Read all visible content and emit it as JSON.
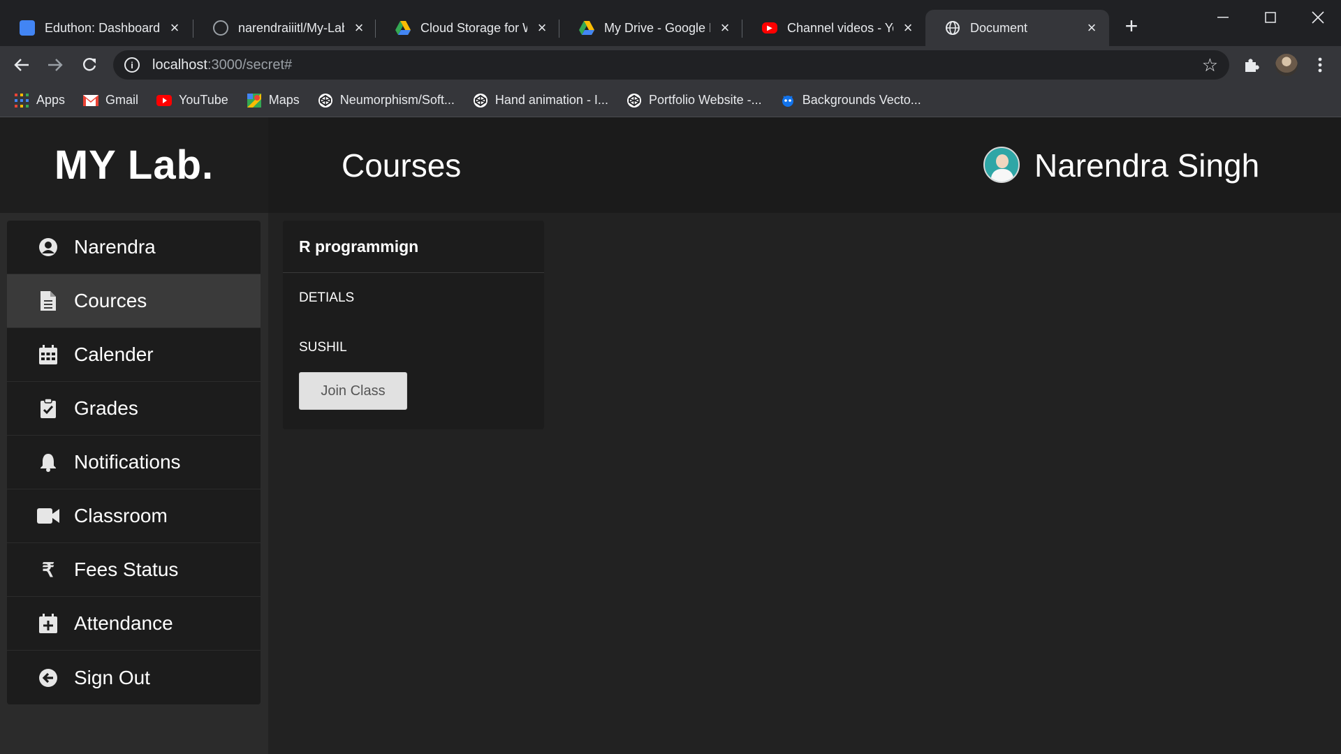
{
  "browser": {
    "tabs": [
      {
        "title": "Eduthon: Dashboard",
        "icon": "eduthon-icon",
        "color": "#4285f4"
      },
      {
        "title": "narendraiiitl/My-Lab",
        "icon": "github-icon",
        "color": "#ffffff"
      },
      {
        "title": "Cloud Storage for W",
        "icon": "google-drive-icon",
        "color": "#fbbc04"
      },
      {
        "title": "My Drive - Google D",
        "icon": "google-drive-icon",
        "color": "#fbbc04"
      },
      {
        "title": "Channel videos - You",
        "icon": "youtube-icon",
        "color": "#ff0000"
      },
      {
        "title": "Document",
        "icon": "globe-icon",
        "color": "#e8eaed"
      }
    ],
    "url_host": "localhost",
    "url_path": ":3000/secret#",
    "bookmarks": [
      {
        "label": "Apps",
        "icon": "apps-grid-icon"
      },
      {
        "label": "Gmail",
        "icon": "gmail-icon"
      },
      {
        "label": "YouTube",
        "icon": "youtube-icon"
      },
      {
        "label": "Maps",
        "icon": "maps-icon"
      },
      {
        "label": "Neumorphism/Soft...",
        "icon": "codepen-icon"
      },
      {
        "label": "Hand animation - I...",
        "icon": "codepen-icon"
      },
      {
        "label": "Portfolio Website -...",
        "icon": "codepen-icon"
      },
      {
        "label": "Backgrounds Vecto...",
        "icon": "freepik-icon"
      }
    ]
  },
  "app": {
    "logo": "MY Lab.",
    "page_title": "Courses",
    "user_name": "Narendra Singh",
    "sidebar": [
      {
        "label": "Narendra",
        "icon": "user-circle-icon",
        "active": false
      },
      {
        "label": "Cources",
        "icon": "document-icon",
        "active": true
      },
      {
        "label": "Calender",
        "icon": "calendar-icon",
        "active": false
      },
      {
        "label": "Grades",
        "icon": "clipboard-check-icon",
        "active": false
      },
      {
        "label": "Notifications",
        "icon": "bell-icon",
        "active": false
      },
      {
        "label": "Classroom",
        "icon": "video-camera-icon",
        "active": false
      },
      {
        "label": "Fees Status",
        "icon": "rupee-icon",
        "active": false
      },
      {
        "label": "Attendance",
        "icon": "calendar-plus-icon",
        "active": false
      },
      {
        "label": "Sign Out",
        "icon": "arrow-circle-left-icon",
        "active": false
      }
    ],
    "course_card": {
      "title": "R programmign",
      "details_label": "DETIALS",
      "teacher": "SUSHIL",
      "join_label": "Join Class"
    }
  }
}
